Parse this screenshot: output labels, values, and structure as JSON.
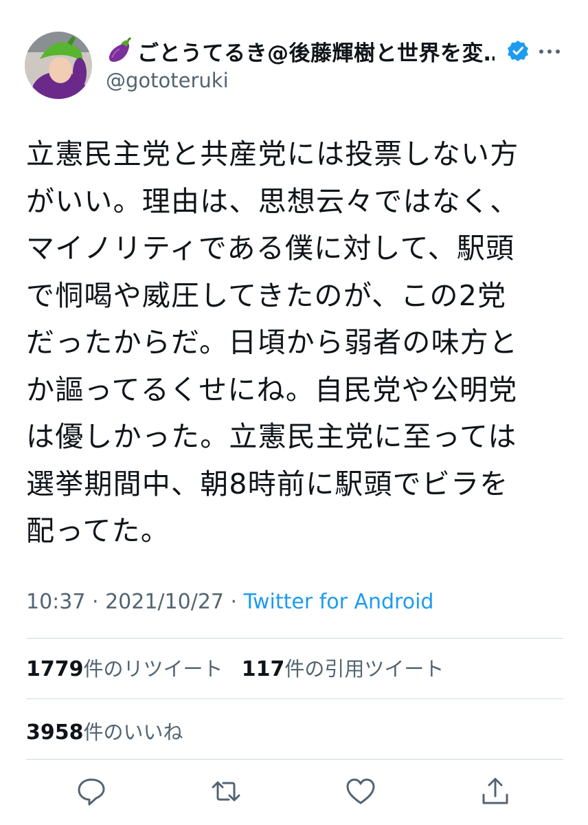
{
  "author": {
    "emoji_icon": "eggplant-icon",
    "display_name": "ごとうてるき@後藤輝樹と世界を変…",
    "handle": "@gototeruki",
    "verified_icon": "verified-badge-icon"
  },
  "tweet": {
    "lines": [
      "立憲民主党と共産党には投票しない方",
      "がいい。理由は、思想云々ではなく、",
      "マイノリティである僕に対して、駅頭",
      "で恫喝や威圧してきたのが、この2党",
      "だったからだ。日頃から弱者の味方と",
      "か謳ってるくせにね。自民党や公明党",
      "は優しかった。立憲民主党に至っては",
      "選挙期間中、朝8時前に駅頭でビラを",
      "配ってた。"
    ]
  },
  "meta": {
    "time": "10:37",
    "separator": " · ",
    "date": "2021/10/27",
    "source": "Twitter for Android"
  },
  "stats": {
    "retweet_count": "1779",
    "retweet_label": "件のリツイート",
    "quote_count": "117",
    "quote_label": "件の引用ツイート",
    "like_count": "3958",
    "like_label": "件のいいね"
  },
  "colors": {
    "link": "#1d9bf0",
    "muted": "#536471",
    "text": "#0f1419",
    "divider": "#cfd9de",
    "eggplant": "#6b2a8a"
  },
  "actions": [
    "reply-icon",
    "retweet-icon",
    "like-icon",
    "share-icon"
  ]
}
